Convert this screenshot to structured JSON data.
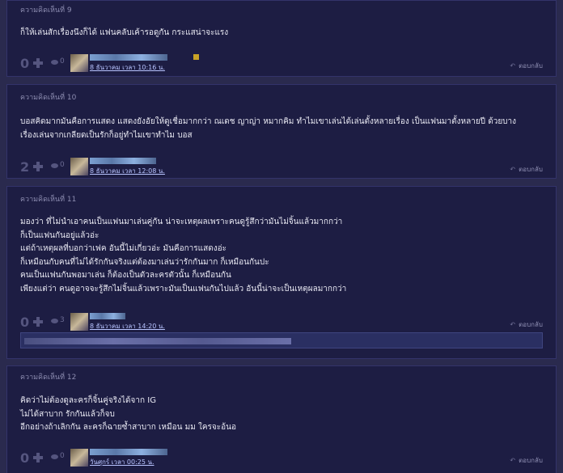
{
  "comments": [
    {
      "label": "ความคิดเห็นที่ 9",
      "lines": [
        "ก็ให้เล่นสักเรื่องนึงก็ได้ แฟนคลับเค้ารอดูกัน กระแสน่าจะแรง"
      ],
      "score": "0",
      "views": "0",
      "date": "8 ธันวาคม เวลา 10:16 น.",
      "reply": "ตอบกลับ"
    },
    {
      "label": "ความคิดเห็นที่ 10",
      "lines": [
        "บอสคิดมากมันคือการแสดง แสดงยังอัยให้ดูเชื่อมากกว่า ณเดช ญาญ่า หมากคิม ทำไมเขาเล่นได้เล่นตั้งหลายเรื่อง เป็นแฟนมาตั้งหลายปี ด้วยบาง",
        "เรื่องเล่นจากเกลียดเป็นรักก็อยู่ทำไมเขาทำไม บอส"
      ],
      "score": "2",
      "views": "0",
      "date": "8 ธันวาคม เวลา 12:08 น.",
      "reply": "ตอบกลับ"
    },
    {
      "label": "ความคิดเห็นที่ 11",
      "lines": [
        "มองว่า ที่ไม่นำเอาคนเป็นแฟนมาเล่นคู่กัน น่าจะเหตุผลเพราะคนดูรู้สึกว่ามันไม่จิ้นแล้วมากกว่า",
        "ก็เป็นแฟนกันอยู่แล้วอ่ะ",
        "แต่ถ้าเหตุผลที่บอกว่าเฟค อันนี้ไม่เกี่ยวอ่ะ มันคือการแสดงอ่ะ",
        "ก็เหมือนกับคนที่ไม่ได้รักกันจริงแต่ต้องมาเล่นว่ารักกันมาก ก็เหมือนกันปะ",
        "คนเป็นแฟนกันพอมาเล่น ก็ต้องเป็นตัวละครตัวนั้น ก็เหมือนกัน",
        "เพียงแต่ว่า คนดูอาจจะรู้สึกไม่จิ้นแล้วเพราะมันเป็นแฟนกันไปแล้ว อันนี้น่าจะเป็นเหตุผลมากกว่า"
      ],
      "score": "0",
      "views": "3",
      "date": "8 ธันวาคม เวลา 14:20 น.",
      "reply": "ตอบกลับ"
    },
    {
      "label": "ความคิดเห็นที่ 12",
      "lines": [
        "คิดว่าไม่ต้องดูละครก็จิ้นคู่จริงได้จาก IG",
        "ไม่ได้สาบาก รักกันแล้วก็จบ",
        "อีกอย่างถ้าเลิกกัน ละครก็ฉายซ้ำสาบาก เหมือน มม ใครจะอ้นอ"
      ],
      "score": "0",
      "views": "0",
      "date": "วันศุกร์ เวลา 00:25 น.",
      "reply": "ตอบกลับ"
    }
  ],
  "colors": {
    "page_bg": "#2a2a4e",
    "card_bg": "#1d1d43",
    "link": "#b8c4ff",
    "muted": "#8c8cb0"
  },
  "icons": [
    "plus-icon",
    "eye-icon",
    "reply-icon",
    "badge-icon"
  ]
}
